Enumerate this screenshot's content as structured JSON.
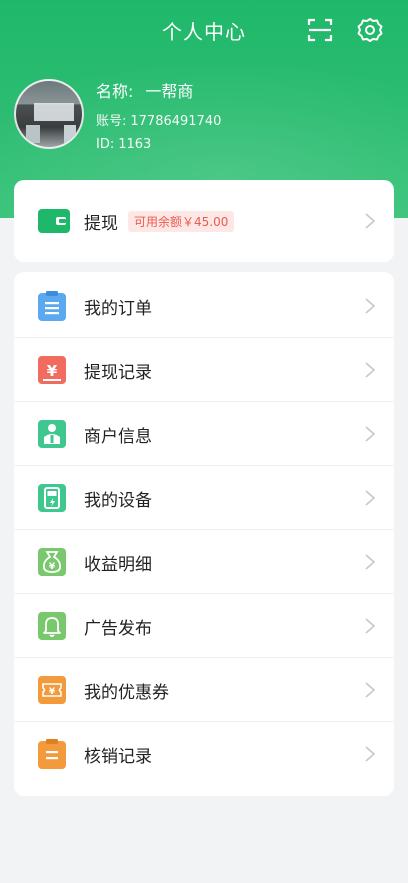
{
  "header": {
    "title": "个人中心",
    "scan_icon": "scan-icon",
    "settings_icon": "gear-icon"
  },
  "profile": {
    "name_label": "名称:",
    "name_value": "一帮商",
    "account_label": "账号:",
    "account_value": "17786491740",
    "id_label": "ID:",
    "id_value": "1163"
  },
  "withdraw": {
    "label": "提现",
    "balance_text": "可用余额￥45.00",
    "icon": "wallet-icon"
  },
  "menu": [
    {
      "label": "我的订单",
      "icon": "clipboard-icon",
      "color": "#5aa9f0"
    },
    {
      "label": "提现记录",
      "icon": "yen-record-icon",
      "color": "#f26b5f"
    },
    {
      "label": "商户信息",
      "icon": "merchant-icon",
      "color": "#3ec78e"
    },
    {
      "label": "我的设备",
      "icon": "device-icon",
      "color": "#3ec78e"
    },
    {
      "label": "收益明细",
      "icon": "money-bag-icon",
      "color": "#7ac86e"
    },
    {
      "label": "广告发布",
      "icon": "bell-icon",
      "color": "#7ac86e"
    },
    {
      "label": "我的优惠券",
      "icon": "coupon-icon",
      "color": "#f29a3c"
    },
    {
      "label": "核销记录",
      "icon": "clipboard-list-icon",
      "color": "#f29a3c"
    }
  ]
}
